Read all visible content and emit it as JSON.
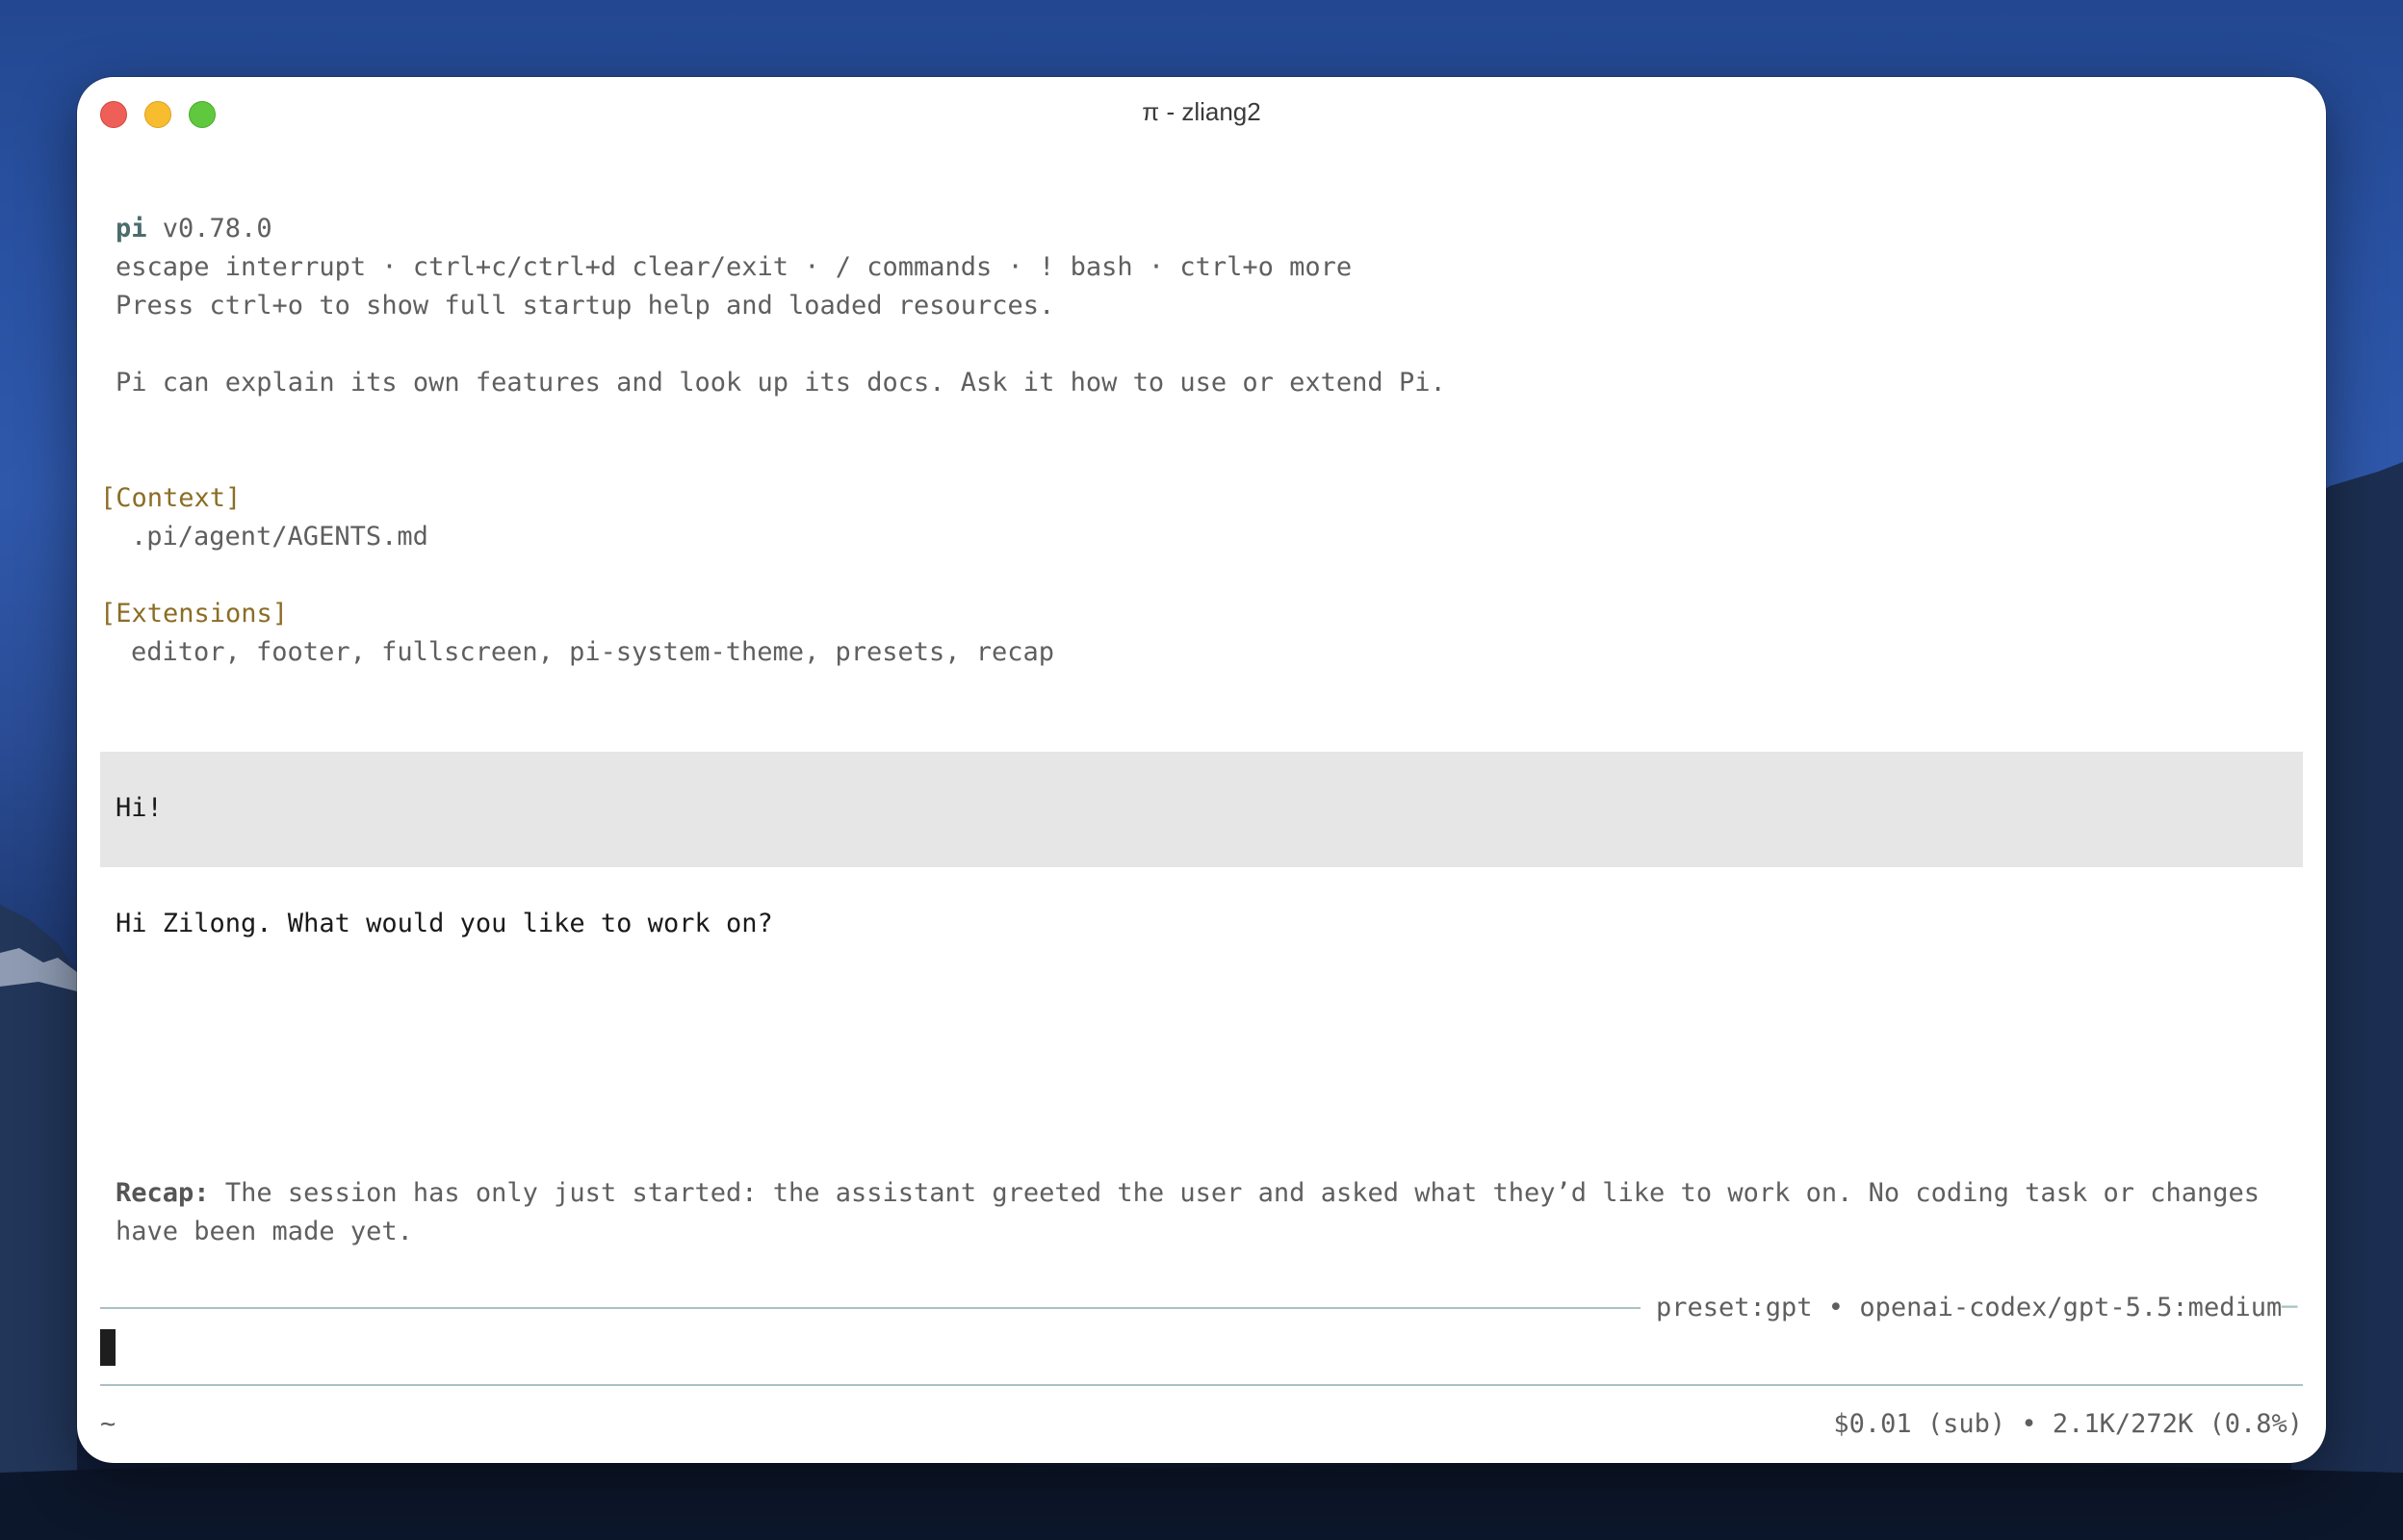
{
  "window": {
    "title": "π - zliang2"
  },
  "header": {
    "app_name": "pi",
    "version": "v0.78.0",
    "shortcuts": "escape interrupt · ctrl+c/ctrl+d clear/exit · / commands · ! bash · ctrl+o more",
    "help_hint": "Press ctrl+o to show full startup help and loaded resources.",
    "intro": "Pi can explain its own features and look up its docs. Ask it how to use or extend Pi."
  },
  "context": {
    "heading": "[Context]",
    "file": ".pi/agent/AGENTS.md"
  },
  "extensions": {
    "heading": "[Extensions]",
    "list": "editor, footer, fullscreen, pi-system-theme, presets, recap"
  },
  "conversation": {
    "user_message": "Hi!",
    "assistant_message": "Hi Zilong. What would you like to work on?"
  },
  "recap": {
    "label": "Recap:",
    "line1": "The session has only just started: the assistant greeted the user and asked what they’d like to work on. No coding task or changes",
    "line2": "have been made yet."
  },
  "editor": {
    "model_status": "preset:gpt • openai-codex/gpt-5.5:medium",
    "rule_tail": "─"
  },
  "footer": {
    "cwd": "~",
    "usage": "$0.01 (sub) • 2.1K/272K (0.8%)"
  },
  "colors": {
    "accent": "#4b6d6e",
    "section": "#8b6d25",
    "user_block_bg": "#e6e6e6",
    "rule": "#a9c1c2"
  }
}
